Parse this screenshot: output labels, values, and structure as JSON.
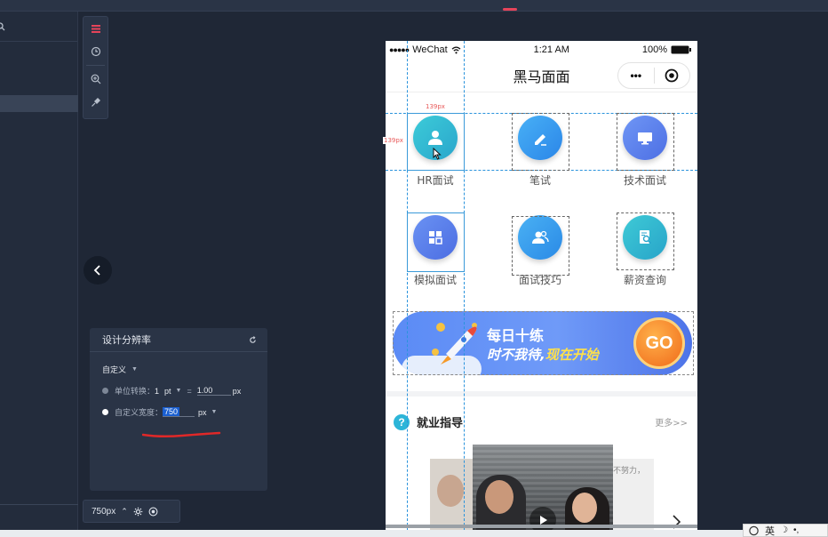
{
  "resolution_panel": {
    "title": "设计分辨率",
    "mode": "自定义",
    "unit_label": "单位转换：",
    "unit_value": "1",
    "unit_name": "pt",
    "equals": "=",
    "unit_result": "1.00",
    "unit_px": "px",
    "width_label": "自定义宽度：",
    "width_value": "750",
    "width_unit": "px"
  },
  "zoombar": {
    "value": "750px",
    "caret": "⌃"
  },
  "phone": {
    "status": {
      "carrier_dots": "●●●●●",
      "carrier": "WeChat",
      "time": "1:21 AM",
      "battery": "100%"
    },
    "nav": {
      "title": "黑马面面",
      "more": "•••"
    },
    "grid": [
      {
        "label": "HR面试",
        "icon": "user-icon",
        "color": "#2fb8cf"
      },
      {
        "label": "笔试",
        "icon": "pencil-icon",
        "color": "#3a9cf0"
      },
      {
        "label": "技术面试",
        "icon": "monitor-icon",
        "color": "#5b82ee"
      },
      {
        "label": "模拟面试",
        "icon": "tiles-icon",
        "color": "#5a86ef"
      },
      {
        "label": "面试技巧",
        "icon": "people-icon",
        "color": "#3aa0ee"
      },
      {
        "label": "薪资查询",
        "icon": "doc-search-icon",
        "color": "#34b6cf"
      }
    ],
    "banner": {
      "line1": "每日十练",
      "line2_white": "时不我待,",
      "line2_yellow": "现在开始",
      "go": "GO"
    },
    "section": {
      "title": "就业指导",
      "more": "更多>>"
    },
    "video_overlay_text": "不努力，"
  },
  "measure": {
    "width_label": "139px",
    "height_label": "139px"
  },
  "ime": {
    "lang": "英"
  },
  "colors": {
    "accent_red": "#e6445a",
    "guide_blue": "#2a93dc",
    "panel_bg": "#2a3446"
  }
}
